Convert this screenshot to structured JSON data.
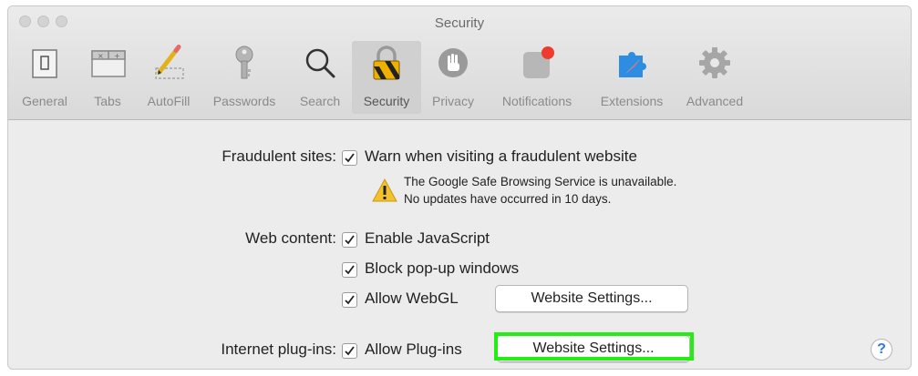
{
  "window": {
    "title": "Security"
  },
  "toolbar": {
    "items": [
      {
        "label": "General",
        "icon": "general-icon"
      },
      {
        "label": "Tabs",
        "icon": "tabs-icon"
      },
      {
        "label": "AutoFill",
        "icon": "autofill-icon"
      },
      {
        "label": "Passwords",
        "icon": "key-icon"
      },
      {
        "label": "Search",
        "icon": "magnifier-icon"
      },
      {
        "label": "Security",
        "icon": "lock-icon",
        "selected": true
      },
      {
        "label": "Privacy",
        "icon": "hand-icon"
      },
      {
        "label": "Notifications",
        "icon": "notifications-icon"
      },
      {
        "label": "Extensions",
        "icon": "puzzle-icon"
      },
      {
        "label": "Advanced",
        "icon": "gear-icon"
      }
    ]
  },
  "fraudulent": {
    "label": "Fraudulent sites:",
    "checkbox_label": "Warn when visiting a fraudulent website",
    "checked": true,
    "warning_line1": "The Google Safe Browsing Service is unavailable.",
    "warning_line2": "No updates have occurred in 10 days."
  },
  "web_content": {
    "label": "Web content:",
    "options": [
      {
        "label": "Enable JavaScript",
        "checked": true
      },
      {
        "label": "Block pop-up windows",
        "checked": true
      },
      {
        "label": "Allow WebGL",
        "checked": true
      }
    ],
    "settings_button": "Website Settings..."
  },
  "plugins": {
    "label": "Internet plug-ins:",
    "checkbox_label": "Allow Plug-ins",
    "checked": true,
    "settings_button": "Website Settings..."
  },
  "help": {
    "label": "?"
  },
  "colors": {
    "highlight": "#22ee11",
    "help_accent": "#2c7be5"
  }
}
